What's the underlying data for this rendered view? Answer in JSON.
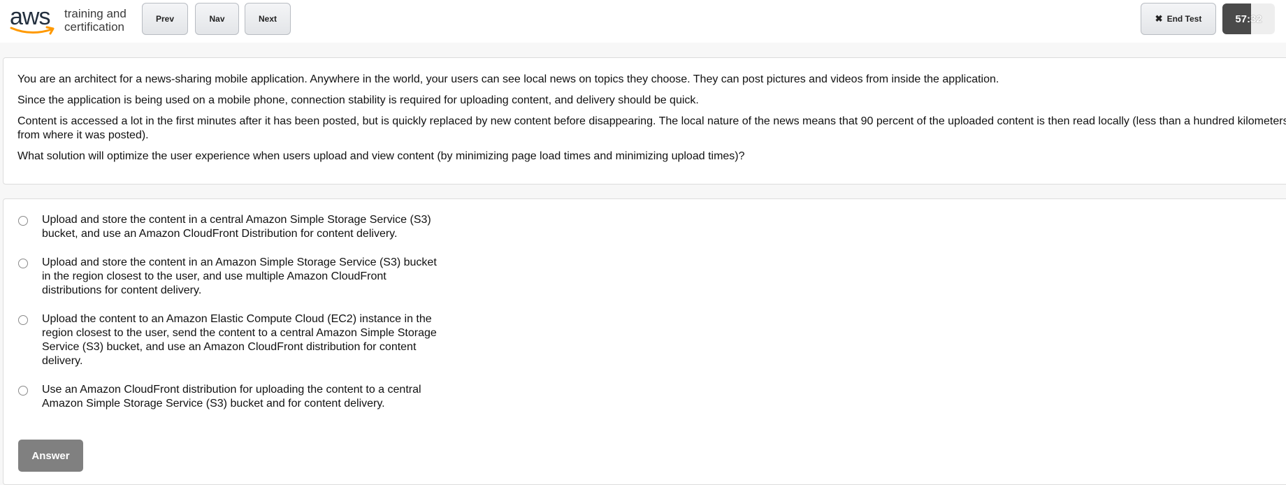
{
  "header": {
    "logo_text": "aws",
    "logo_tagline_1": "training and",
    "logo_tagline_2": "certification",
    "prev_label": "Prev",
    "nav_label": "Nav",
    "next_label": "Next",
    "end_test_label": "End Test",
    "end_test_icon": "close-icon",
    "timer": "57:32",
    "timer_progress": 0.55
  },
  "question": {
    "paragraphs": [
      "You are an architect for a news-sharing mobile application. Anywhere in the world, your users can see local news on topics they choose. They can post pictures and videos from inside the application.",
      "Since the application is being used on a mobile phone, connection stability is required for uploading content, and delivery should be quick.",
      "Content is accessed a lot in the first minutes after it has been posted, but is quickly replaced by new content before disappearing. The local nature of the news means that 90 percent of the uploaded content is then read locally (less than a hundred kilometers",
      "from where it was posted).",
      "What solution will optimize the user experience when users upload and view content (by minimizing page load times and minimizing upload times)?"
    ]
  },
  "answers": {
    "options": [
      "Upload and store the content in a central Amazon Simple Storage Service (S3) bucket, and use an Amazon CloudFront Distribution for content delivery.",
      "Upload and store the content in an Amazon Simple Storage Service (S3) bucket in the region closest to the user, and use multiple Amazon CloudFront distributions for content delivery.",
      "Upload the content to an Amazon Elastic Compute Cloud (EC2) instance in the region closest to the user, send the content to a central Amazon Simple Storage Service (S3) bucket, and use an Amazon CloudFront distribution for content delivery.",
      "Use an Amazon CloudFront distribution for uploading the content to a central Amazon Simple Storage Service (S3) bucket and for content delivery."
    ],
    "answer_label": "Answer"
  },
  "colors": {
    "aws_orange": "#ff9900",
    "aws_navy": "#232f3e",
    "answer_button": "#808080",
    "timer_dark": "#4a4a4a"
  }
}
